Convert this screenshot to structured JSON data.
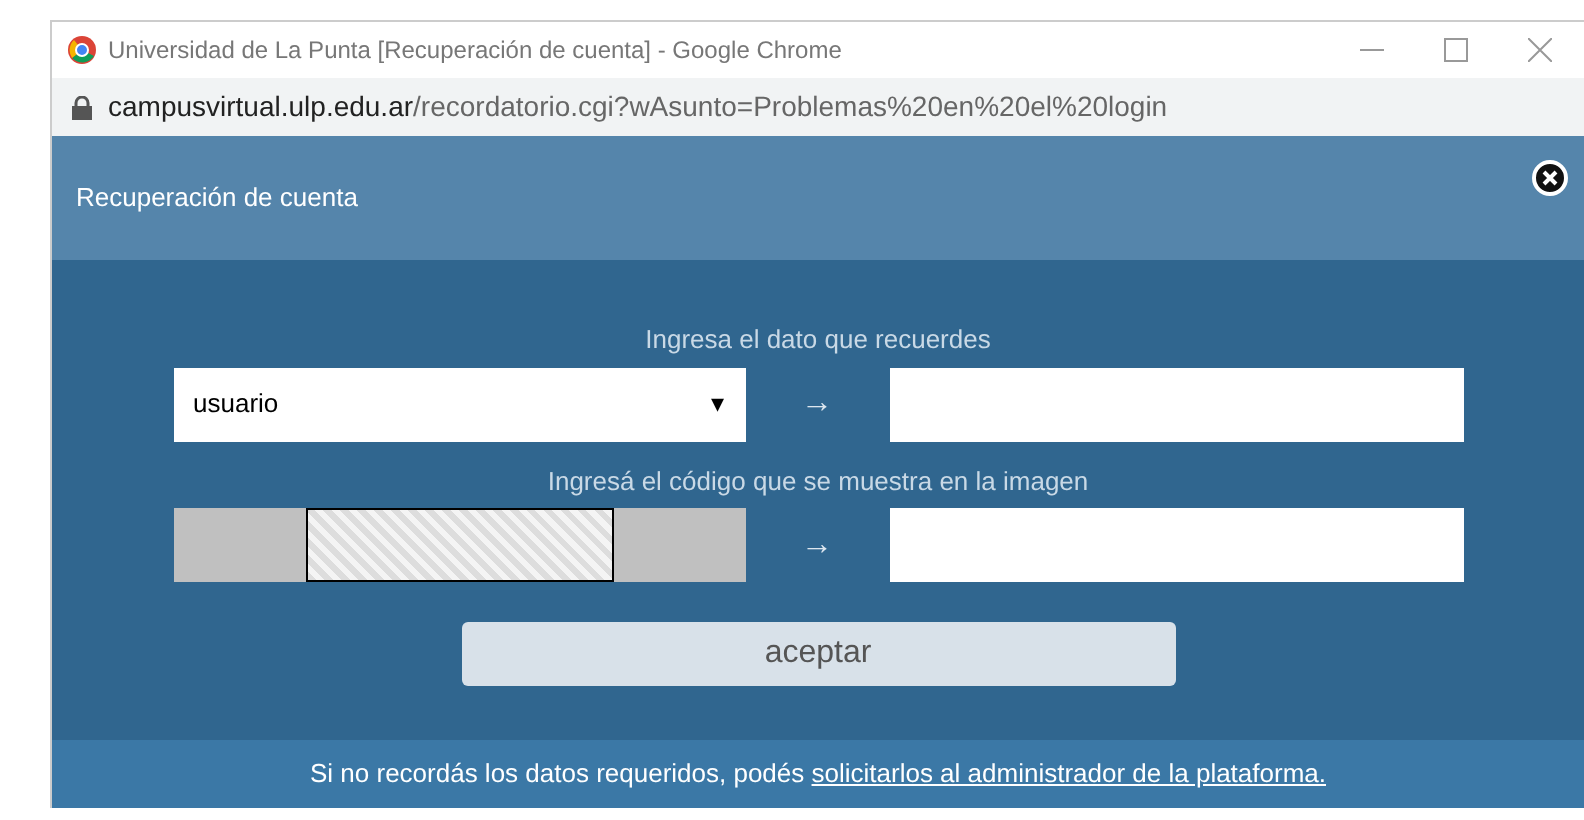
{
  "window": {
    "title": "Universidad de La Punta [Recuperación de cuenta] - Google Chrome"
  },
  "address_bar": {
    "domain": "campusvirtual.ulp.edu.ar",
    "path": "/recordatorio.cgi?wAsunto=Problemas%20en%20el%20login"
  },
  "dialog": {
    "title": "Recuperación de cuenta",
    "data_label": "Ingresa el dato que recuerdes",
    "data_select": {
      "value": "usuario",
      "caret": "▾"
    },
    "arrow_1": "→",
    "code_label": "Ingresá el código que se muestra en la imagen",
    "arrow_2": "→",
    "submit": "aceptar",
    "footer": {
      "text": "Si no recordás los datos requeridos, podés ",
      "link": "solicitarlos al administrador de la plataforma."
    }
  }
}
